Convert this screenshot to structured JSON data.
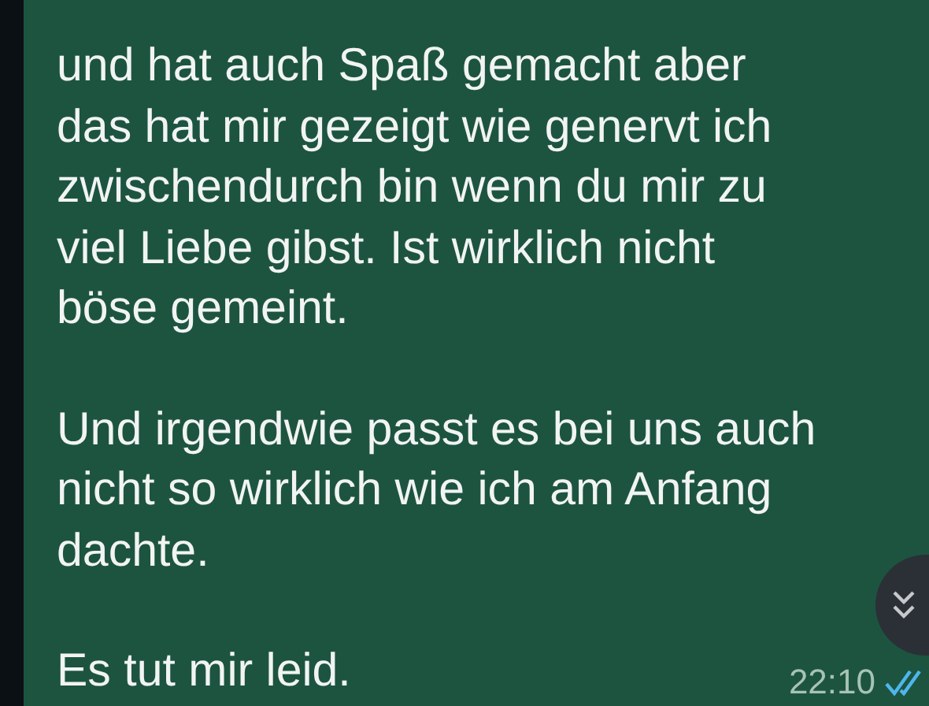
{
  "message": {
    "paragraphs": [
      {
        "lines": [
          "und hat auch Spaß gemacht aber",
          "das hat mir gezeigt wie genervt ich",
          "zwischendurch bin wenn du mir zu",
          "viel Liebe gibst. Ist wirklich nicht",
          "böse gemeint."
        ]
      },
      {
        "lines": [
          "Und irgendwie passt es bei uns auch",
          "nicht so wirklich wie ich am Anfang",
          "dachte."
        ]
      },
      {
        "lines": [
          "Es tut mir leid."
        ]
      }
    ],
    "time": "22:10",
    "read": true
  }
}
